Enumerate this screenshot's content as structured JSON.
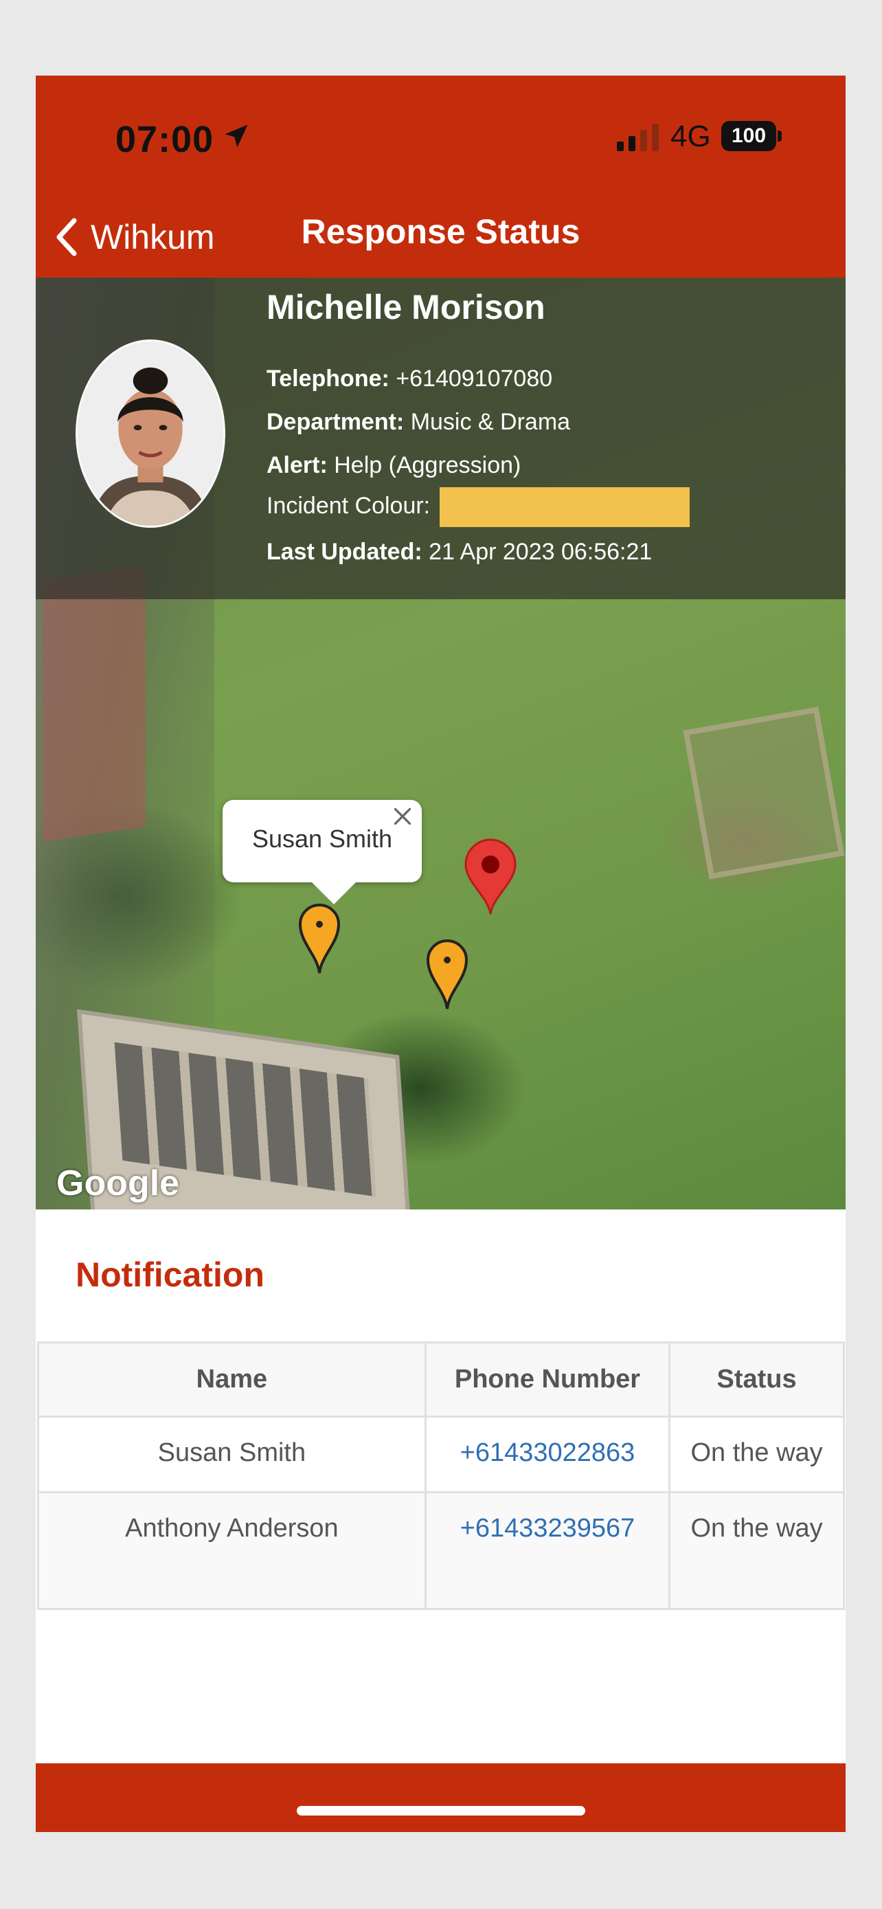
{
  "status_bar": {
    "time": "07:00",
    "network": "4G",
    "battery": "100"
  },
  "nav": {
    "back_label": "Wihkum",
    "title": "Response Status"
  },
  "profile": {
    "name": "Michelle Morison",
    "telephone_label": "Telephone:",
    "telephone": "+61409107080",
    "department_label": "Department:",
    "department": "Music & Drama",
    "alert_label": "Alert:",
    "alert": "Help (Aggression)",
    "incident_colour_label": "Incident Colour:",
    "incident_colour": "#f2c14e",
    "last_updated_label": "Last Updated:",
    "last_updated": "21 Apr 2023 06:56:21"
  },
  "map": {
    "callout_text": "Susan Smith",
    "attribution": "Google",
    "marker_colors": {
      "incident": "#e53935",
      "responder": "#f5a623"
    }
  },
  "notification": {
    "title": "Notification",
    "columns": [
      "Name",
      "Phone Number",
      "Status"
    ],
    "rows": [
      {
        "name": "Susan Smith",
        "phone": "+61433022863",
        "status": "On the way"
      },
      {
        "name": "Anthony Anderson",
        "phone": "+61433239567",
        "status": "On the way"
      }
    ]
  },
  "colors": {
    "brand": "#c42d0c",
    "link": "#2f6fb5"
  }
}
